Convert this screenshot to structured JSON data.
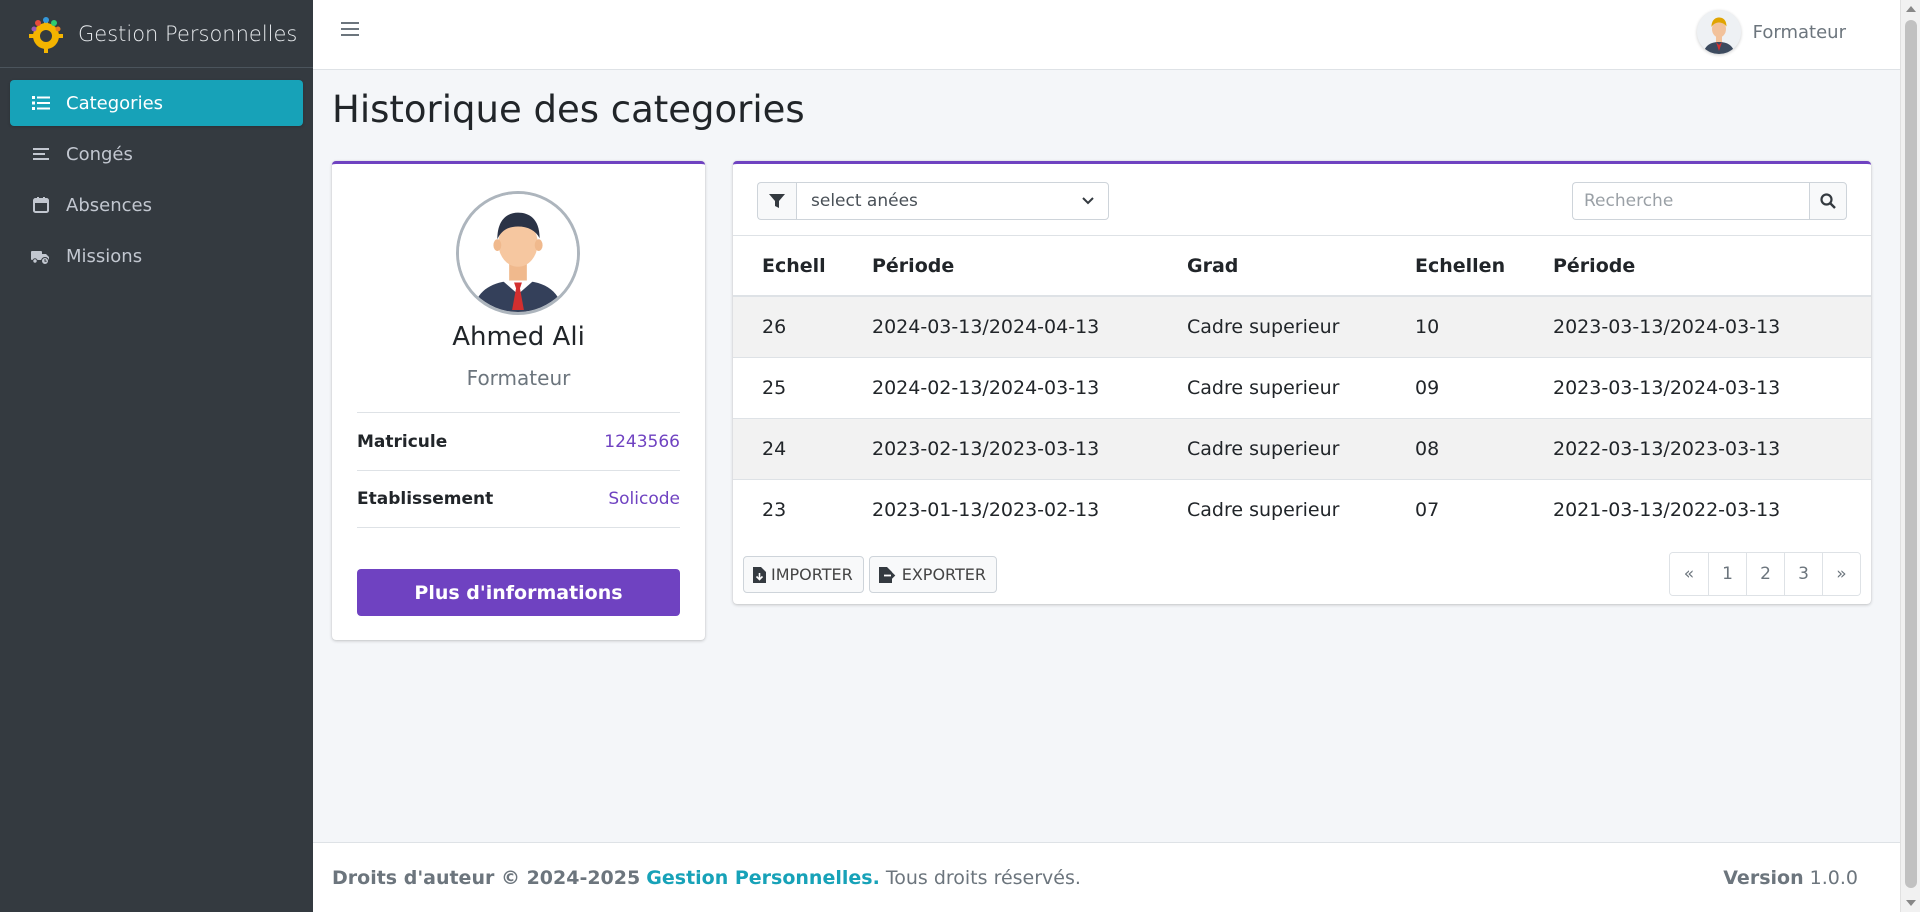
{
  "brand": {
    "title": "Gestion Personnelles",
    "logo_icon": "gear-people-logo-icon"
  },
  "sidebar": {
    "items": [
      {
        "label": "Categories",
        "icon": "list-icon",
        "active": true
      },
      {
        "label": "Congés",
        "icon": "bars-icon",
        "active": false
      },
      {
        "label": "Absences",
        "icon": "calendar-icon",
        "active": false
      },
      {
        "label": "Missions",
        "icon": "truck-clock-icon",
        "active": false
      }
    ]
  },
  "header": {
    "user_name": "Formateur",
    "avatar_icon": "user-avatar-icon"
  },
  "page": {
    "title": "Historique des categories"
  },
  "profile": {
    "name": "Ahmed Ali",
    "role": "Formateur",
    "fields": [
      {
        "label": "Matricule",
        "value": "1243566"
      },
      {
        "label": "Etablissement",
        "value": "Solicode"
      }
    ],
    "more_button": "Plus d'informations"
  },
  "filters": {
    "select_value": "select anées",
    "search_placeholder": "Recherche"
  },
  "table": {
    "headers": [
      "Echell",
      "Période",
      "Grad",
      "Echellen",
      "Période"
    ],
    "rows": [
      [
        "26",
        "2024-03-13/2024-04-13",
        "Cadre superieur",
        "10",
        "2023-03-13/2024-03-13"
      ],
      [
        "25",
        "2024-02-13/2024-03-13",
        "Cadre superieur",
        "09",
        "2023-03-13/2024-03-13"
      ],
      [
        "24",
        "2023-02-13/2023-03-13",
        "Cadre superieur",
        "08",
        "2022-03-13/2023-03-13"
      ],
      [
        "23",
        "2023-01-13/2023-02-13",
        "Cadre superieur",
        "07",
        "2021-03-13/2022-03-13"
      ]
    ]
  },
  "actions": {
    "import_label": "IMPORTER",
    "export_label": "EXPORTER"
  },
  "pagination": [
    "«",
    "1",
    "2",
    "3",
    "»"
  ],
  "footer": {
    "copyright": "Droits d'auteur © 2024-2025",
    "brand": "Gestion Personnelles.",
    "rights": "Tous droits réservés.",
    "version_label": "Version",
    "version_value": "1.0.0"
  },
  "colors": {
    "accent": "#6f42c1",
    "active_nav": "#17a2b8",
    "sidebar_bg": "#343a40"
  }
}
